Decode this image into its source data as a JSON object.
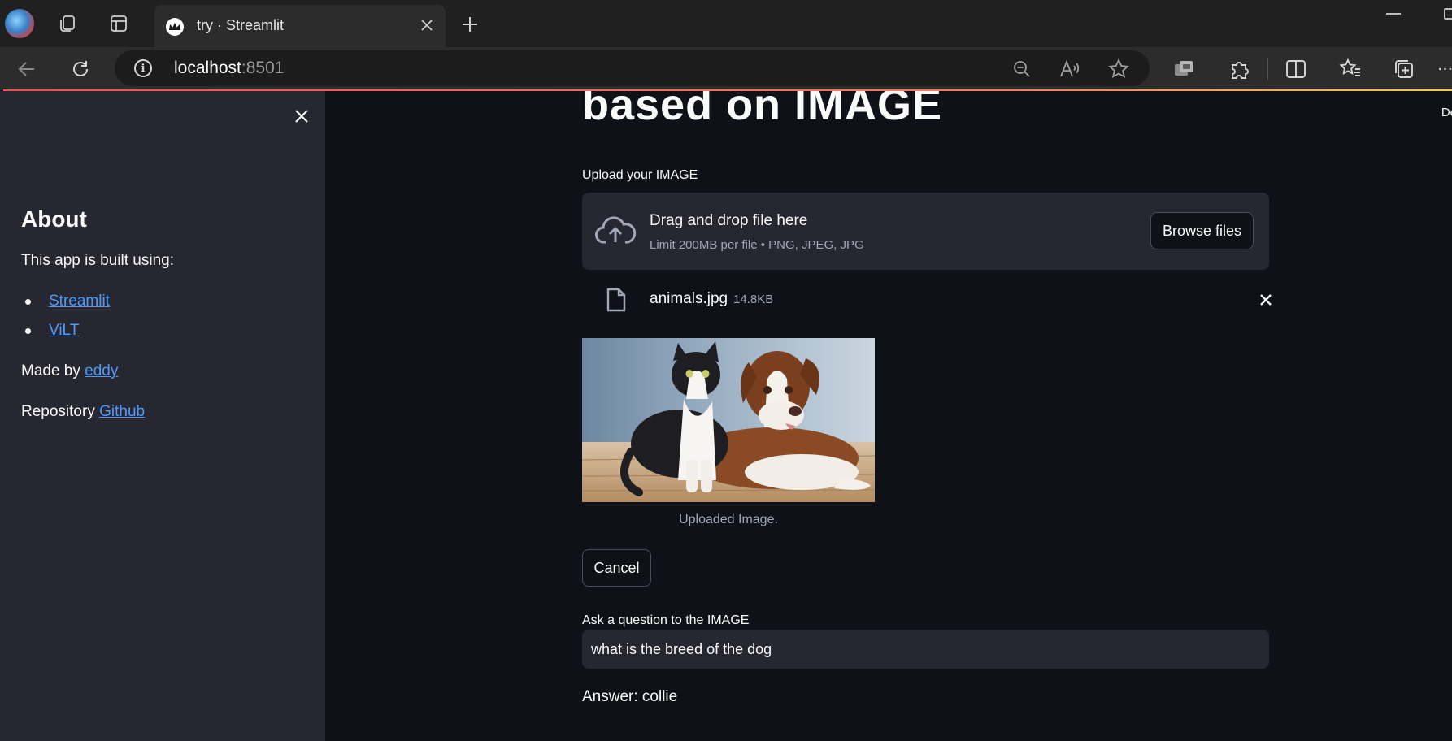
{
  "browser": {
    "tab_title": "try · Streamlit",
    "address_host": "localhost",
    "address_port": ":8501"
  },
  "sidebar": {
    "heading": "About",
    "intro": "This app is built using:",
    "links": [
      {
        "label": "Streamlit"
      },
      {
        "label": "ViLT"
      }
    ],
    "made_by_prefix": "Made by ",
    "made_by_link": "eddy",
    "repo_prefix": "Repository ",
    "repo_link": "Github"
  },
  "main": {
    "title_partial": "based on IMAGE",
    "corner_text": "De",
    "upload_label": "Upload your IMAGE",
    "dropzone_main": "Drag and drop file here",
    "dropzone_sub": "Limit 200MB per file • PNG, JPEG, JPG",
    "browse_label": "Browse files",
    "file_name": "animals.jpg",
    "file_size": "14.8KB",
    "image_caption": "Uploaded Image.",
    "cancel_label": "Cancel",
    "question_label": "Ask a question to the IMAGE",
    "question_value": "what is the breed of the dog",
    "answer_text": "Answer: collie"
  },
  "colors": {
    "app_bg": "#0e1117",
    "sidebar_bg": "#262730",
    "link": "#4e9bff",
    "accent": "#ff4b4b"
  }
}
